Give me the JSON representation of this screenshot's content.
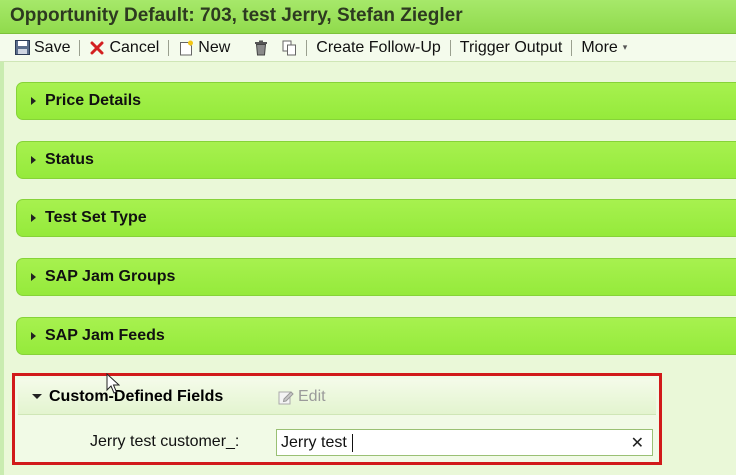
{
  "window": {
    "title": "Opportunity Default: 703, test Jerry, Stefan Ziegler"
  },
  "toolbar": {
    "save": "Save",
    "cancel": "Cancel",
    "new": "New",
    "create_follow_up": "Create Follow-Up",
    "trigger_output": "Trigger Output",
    "more": "More"
  },
  "sections": [
    {
      "label": "Price Details"
    },
    {
      "label": "Status"
    },
    {
      "label": "Test Set Type"
    },
    {
      "label": "SAP Jam Groups"
    },
    {
      "label": "SAP Jam Feeds"
    }
  ],
  "custom_fields": {
    "title": "Custom-Defined Fields",
    "edit_label": "Edit",
    "field_label": "Jerry test customer_:",
    "field_value": "Jerry test",
    "clear_glyph": "✕"
  },
  "colors": {
    "section_green": "#9cee45",
    "highlight_red": "#d11a1a",
    "cancel_red": "#d32020"
  },
  "icons": [
    "save-icon",
    "cancel-icon",
    "new-icon",
    "delete-icon",
    "copy-icon",
    "chevron-down-icon",
    "edit-icon",
    "clear-icon"
  ]
}
